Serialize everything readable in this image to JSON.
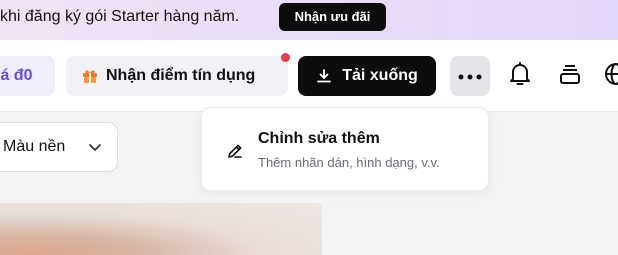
{
  "promo": {
    "text": "khi đăng ký gói Starter hàng năm.",
    "cta_label": "Nhận ưu đãi"
  },
  "toolbar": {
    "price_label": "iá đ0",
    "credit_label": "Nhận điểm tín dụng",
    "download_label": "Tải xuống"
  },
  "background_select": {
    "value": "Màu nền"
  },
  "more_menu": {
    "items": [
      {
        "title": "Chỉnh sửa thêm",
        "subtitle": "Thêm nhãn dán, hình dạng, v.v."
      }
    ]
  },
  "colors": {
    "accent": "#6a4be0",
    "primary_button": "#0d0d0d",
    "notification_dot": "#ef3b50"
  },
  "icons": [
    "gift-icon",
    "download-icon",
    "more-dots-icon",
    "bell-icon",
    "layers-icon",
    "globe-icon",
    "chevron-down-icon",
    "pencil-icon"
  ]
}
